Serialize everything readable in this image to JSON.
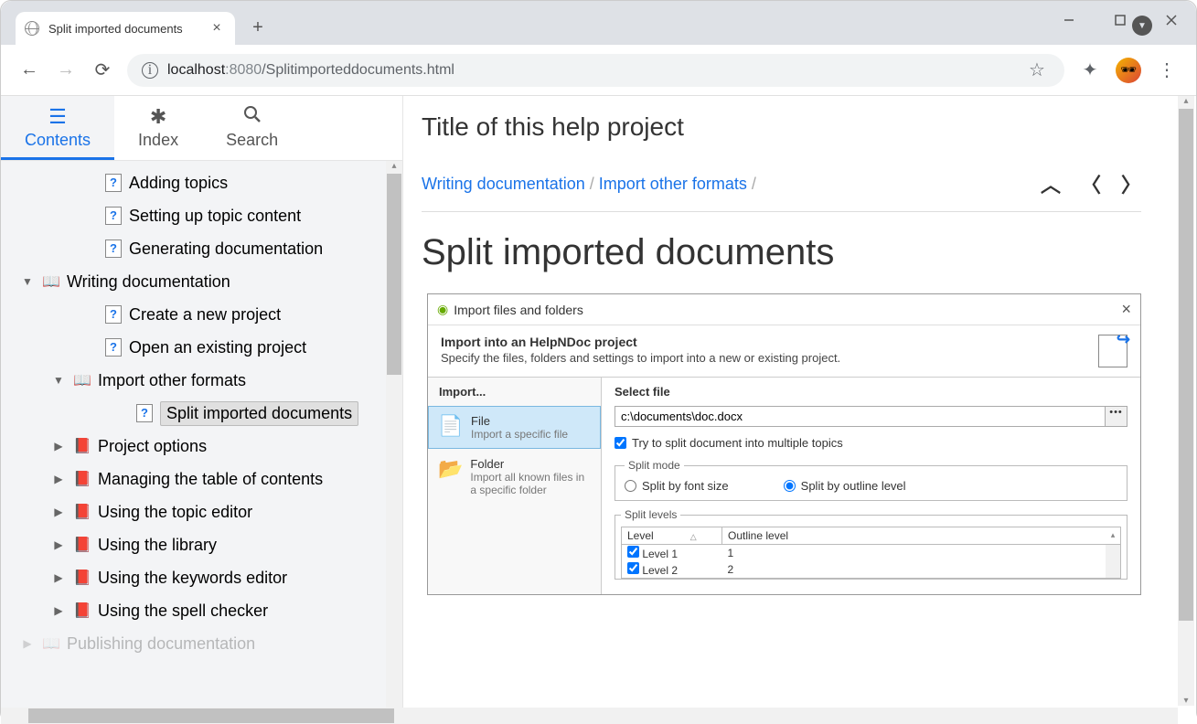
{
  "browser": {
    "tab_title": "Split imported documents",
    "url_host": "localhost",
    "url_port": ":8080",
    "url_path": "/Splitimporteddocuments.html"
  },
  "sidebar": {
    "tabs": {
      "contents": "Contents",
      "index": "Index",
      "search": "Search"
    },
    "items": [
      {
        "indent": 2,
        "icon": "help",
        "label": "Adding topics"
      },
      {
        "indent": 2,
        "icon": "help",
        "label": "Setting up topic content"
      },
      {
        "indent": 2,
        "icon": "help",
        "label": "Generating documentation"
      },
      {
        "indent": 0,
        "icon": "openbook",
        "label": "Writing documentation",
        "chev": "down"
      },
      {
        "indent": 2,
        "icon": "help",
        "label": "Create a new project"
      },
      {
        "indent": 2,
        "icon": "help",
        "label": "Open an existing project"
      },
      {
        "indent": 1,
        "icon": "openbook",
        "label": "Import other formats",
        "chev": "down"
      },
      {
        "indent": 3,
        "icon": "help",
        "label": "Split imported documents",
        "selected": true
      },
      {
        "indent": 1,
        "icon": "book",
        "label": "Project options",
        "chev": "right"
      },
      {
        "indent": 1,
        "icon": "book",
        "label": "Managing the table of contents",
        "chev": "right"
      },
      {
        "indent": 1,
        "icon": "book",
        "label": "Using the topic editor",
        "chev": "right"
      },
      {
        "indent": 1,
        "icon": "book",
        "label": "Using the library",
        "chev": "right"
      },
      {
        "indent": 1,
        "icon": "book",
        "label": "Using the keywords editor",
        "chev": "right"
      },
      {
        "indent": 1,
        "icon": "book",
        "label": "Using the spell checker",
        "chev": "right"
      },
      {
        "indent": 0,
        "icon": "openbook",
        "label": "Publishing documentation",
        "chev": "right",
        "cut": true
      }
    ]
  },
  "main": {
    "project_title": "Title of this help project",
    "breadcrumb": {
      "a": "Writing documentation",
      "b": "Import other formats"
    },
    "heading": "Split imported documents"
  },
  "dialog": {
    "title": "Import files and folders",
    "sub_heading": "Import into an HelpNDoc project",
    "sub_desc": "Specify the files, folders and settings to import into a new or existing project.",
    "left_heading": "Import...",
    "opt_file": {
      "title": "File",
      "desc": "Import a specific file"
    },
    "opt_folder": {
      "title": "Folder",
      "desc": "Import all known files in a specific folder"
    },
    "right_heading": "Select file",
    "file_path": "c:\\documents\\doc.docx",
    "try_split": "Try to split document into multiple topics",
    "split_mode_legend": "Split mode",
    "radio_font": "Split by font size",
    "radio_outline": "Split by outline level",
    "split_levels_legend": "Split levels",
    "col_level": "Level",
    "col_outline": "Outline level",
    "rows": [
      {
        "level": "Level 1",
        "outline": "1"
      },
      {
        "level": "Level 2",
        "outline": "2"
      }
    ]
  }
}
